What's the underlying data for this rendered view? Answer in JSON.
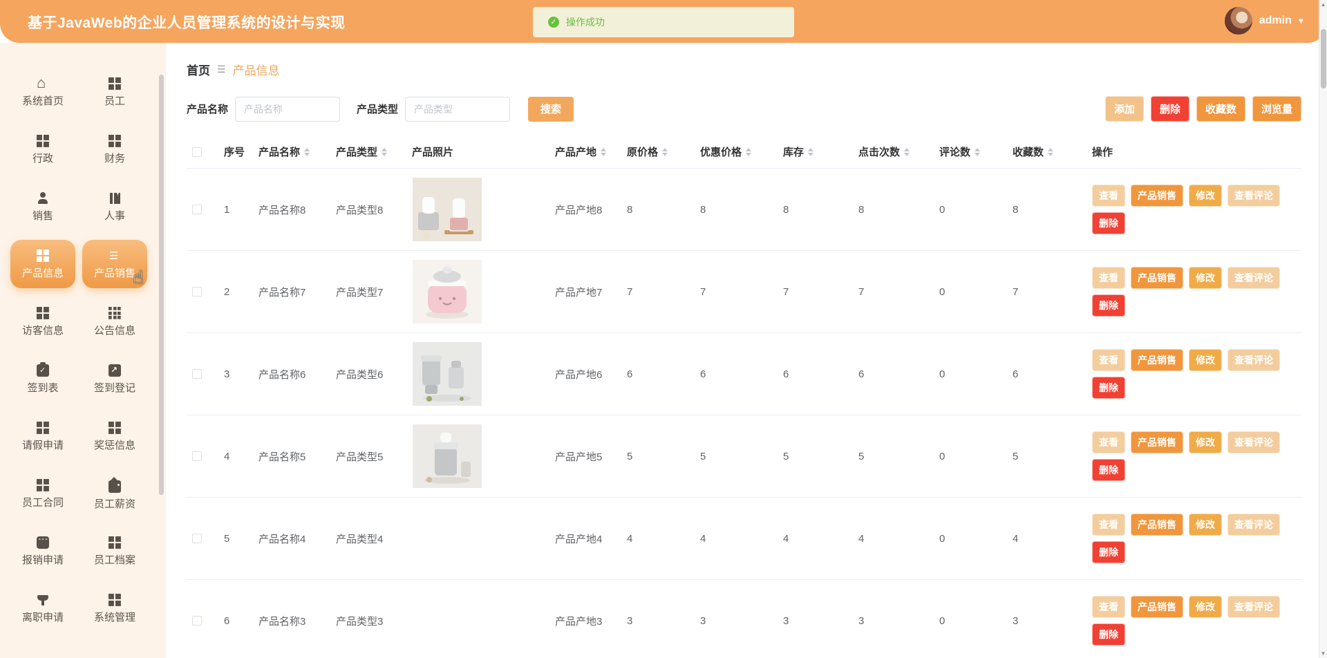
{
  "header": {
    "title": "基于JavaWeb的企业人员管理系统的设计与实现",
    "toast_text": "操作成功",
    "user_name": "admin"
  },
  "sidebar": {
    "items": [
      {
        "key": "home",
        "label": "系统首页",
        "icon": "home",
        "active": false
      },
      {
        "key": "staff",
        "label": "员工",
        "icon": "grid",
        "active": false
      },
      {
        "key": "administration",
        "label": "行政",
        "icon": "grid",
        "active": false
      },
      {
        "key": "finance",
        "label": "财务",
        "icon": "grid",
        "active": false
      },
      {
        "key": "sales",
        "label": "销售",
        "icon": "person",
        "active": false
      },
      {
        "key": "hr",
        "label": "人事",
        "icon": "book",
        "active": false
      },
      {
        "key": "product-info",
        "label": "产品信息",
        "icon": "grid",
        "active": true
      },
      {
        "key": "product-sales",
        "label": "产品销售",
        "icon": "list",
        "active": true
      },
      {
        "key": "visitor-info",
        "label": "访客信息",
        "icon": "grid",
        "active": false
      },
      {
        "key": "announcements",
        "label": "公告信息",
        "icon": "grid9",
        "active": false
      },
      {
        "key": "signin-sheet",
        "label": "签到表",
        "icon": "clipboard",
        "active": false
      },
      {
        "key": "signin-register",
        "label": "签到登记",
        "icon": "trend",
        "active": false
      },
      {
        "key": "leave-request",
        "label": "请假申请",
        "icon": "grid",
        "active": false
      },
      {
        "key": "rewards",
        "label": "奖惩信息",
        "icon": "grid",
        "active": false
      },
      {
        "key": "contracts",
        "label": "员工合同",
        "icon": "grid",
        "active": false
      },
      {
        "key": "salary",
        "label": "员工薪资",
        "icon": "wallet",
        "active": false
      },
      {
        "key": "reimbursement",
        "label": "报销申请",
        "icon": "chat",
        "active": false
      },
      {
        "key": "employee-files",
        "label": "员工档案",
        "icon": "grid",
        "active": false
      },
      {
        "key": "resignation",
        "label": "离职申请",
        "icon": "funnel",
        "active": false
      },
      {
        "key": "system-admin",
        "label": "系统管理",
        "icon": "grid",
        "active": false
      }
    ]
  },
  "breadcrumb": {
    "home": "首页",
    "current": "产品信息"
  },
  "filters": {
    "name_label": "产品名称",
    "name_placeholder": "产品名称",
    "type_label": "产品类型",
    "type_placeholder": "产品类型",
    "search_label": "搜索"
  },
  "toolbar": {
    "add": "添加",
    "delete": "删除",
    "favorites": "收藏数",
    "views": "浏览量"
  },
  "table": {
    "columns": [
      {
        "label": "序号",
        "sortable": false
      },
      {
        "label": "产品名称",
        "sortable": true
      },
      {
        "label": "产品类型",
        "sortable": true
      },
      {
        "label": "产品照片",
        "sortable": false
      },
      {
        "label": "产品产地",
        "sortable": true
      },
      {
        "label": "原价格",
        "sortable": true
      },
      {
        "label": "优惠价格",
        "sortable": true
      },
      {
        "label": "库存",
        "sortable": true
      },
      {
        "label": "点击次数",
        "sortable": true
      },
      {
        "label": "评论数",
        "sortable": true
      },
      {
        "label": "收藏数",
        "sortable": true
      },
      {
        "label": "操作",
        "sortable": false
      }
    ],
    "ops": {
      "view": "查看",
      "sales": "产品销售",
      "edit": "修改",
      "comments": "查看评论",
      "delete": "删除"
    },
    "rows": [
      {
        "index": "1",
        "name": "产品名称8",
        "type": "产品类型8",
        "photo": "chopper-duo",
        "origin": "产品产地8",
        "price": "8",
        "discount_price": "8",
        "stock": "8",
        "clicks": "8",
        "comments": "0",
        "favorites": "8"
      },
      {
        "index": "2",
        "name": "产品名称7",
        "type": "产品类型7",
        "photo": "pink-cooker",
        "origin": "产品产地7",
        "price": "7",
        "discount_price": "7",
        "stock": "7",
        "clicks": "7",
        "comments": "0",
        "favorites": "7"
      },
      {
        "index": "3",
        "name": "产品名称6",
        "type": "产品类型6",
        "photo": "blender-set",
        "origin": "产品产地6",
        "price": "6",
        "discount_price": "6",
        "stock": "6",
        "clicks": "6",
        "comments": "0",
        "favorites": "6"
      },
      {
        "index": "4",
        "name": "产品名称5",
        "type": "产品类型5",
        "photo": "blender-single",
        "origin": "产品产地5",
        "price": "5",
        "discount_price": "5",
        "stock": "5",
        "clicks": "5",
        "comments": "0",
        "favorites": "5"
      },
      {
        "index": "5",
        "name": "产品名称4",
        "type": "产品类型4",
        "photo": null,
        "origin": "产品产地4",
        "price": "4",
        "discount_price": "4",
        "stock": "4",
        "clicks": "4",
        "comments": "0",
        "favorites": "4"
      },
      {
        "index": "6",
        "name": "产品名称3",
        "type": "产品类型3",
        "photo": null,
        "origin": "产品产地3",
        "price": "3",
        "discount_price": "3",
        "stock": "3",
        "clicks": "3",
        "comments": "0",
        "favorites": "3"
      }
    ]
  },
  "colors": {
    "c-header": "#f5a55e",
    "c-sidebar": "#fdf3e8",
    "c-toast-bg": "#f3f0d9",
    "c-green": "#67c23a",
    "c-breadcrumb": "#f2a75b",
    "c-search": "#f2a85c",
    "c-accent": "#f0963c",
    "c-accent-light": "#f2c289",
    "c-amber": "#f0ab49",
    "c-pale": "#f3cd9d",
    "c-red": "#f04134",
    "c-border": "#ebeef5"
  }
}
